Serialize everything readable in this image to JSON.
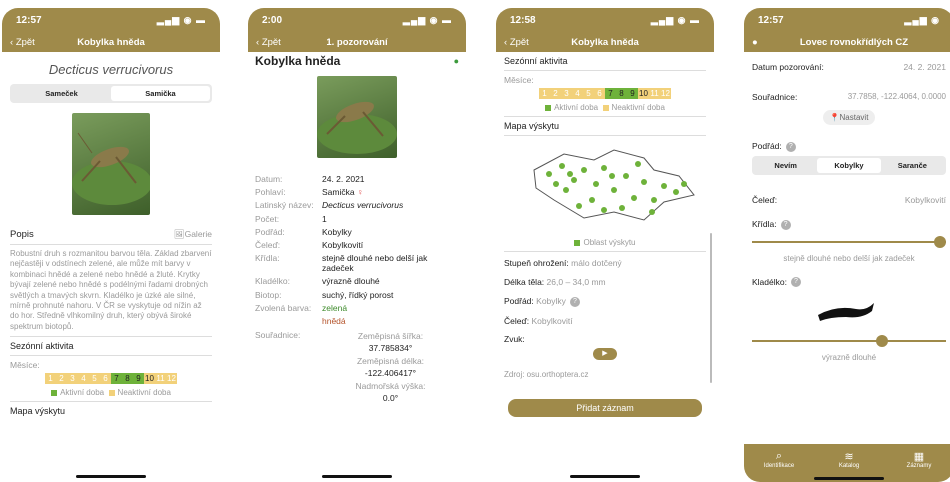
{
  "colors": {
    "brand": "#9f8a4a",
    "active": "#6eb23a",
    "inactive": "#f2d17a",
    "female": "#e04b4b",
    "green_text": "#3c8a2a",
    "brown_text": "#b4532a"
  },
  "s1": {
    "time": "12:57",
    "back": "Zpět",
    "title": "Kobylka hněda",
    "latin": "Decticus verrucivorus",
    "seg": [
      "Sameček",
      "Samička"
    ],
    "popis_label": "Popis",
    "galerie": "Galerie",
    "popis_text": "Robustní druh s rozmanitou barvou těla. Základ zbarvení nejčastěji v odstínech zelené, ale může mít barvy v kombinaci hnědé a zelené nebo hnědé a žluté. Krytky bývají zelené nebo hnědé s podélnými řadami drobných světlých a tmavých skvrn. Kladélko je úzké ale silné, mírně prohnuté nahoru. V ČR se vyskytuje od nížin až do hor. Středně vlhkomilný druh, který obývá široké spektrum biotopů.",
    "sezonni": "Sezónní aktivita",
    "mesice": "Měsíce:",
    "months": [
      "1",
      "2",
      "3",
      "4",
      "5",
      "6",
      "7",
      "8",
      "9",
      "10",
      "11",
      "12"
    ],
    "aktivni": "Aktivní doba",
    "neaktivni": "Neaktivní doba",
    "mapa": "Mapa výskytu"
  },
  "s2": {
    "time": "2:00",
    "back": "Zpět",
    "title": "1. pozorování",
    "name": "Kobylka hněda",
    "rows": [
      {
        "k": "Datum:",
        "v": "24. 2. 2021"
      },
      {
        "k": "Pohlaví:",
        "v": "Samička"
      },
      {
        "k": "Latinský název:",
        "v": "Decticus verrucivorus"
      },
      {
        "k": "Počet:",
        "v": "1"
      },
      {
        "k": "Podřád:",
        "v": "Kobylky"
      },
      {
        "k": "Čeleď:",
        "v": "Kobylkovití"
      },
      {
        "k": "Křídla:",
        "v": "stejně dlouhé nebo delší jak zadeček"
      },
      {
        "k": "Kladélko:",
        "v": "výrazně dlouhé"
      },
      {
        "k": "Biotop:",
        "v": "suchý, řídký porost"
      }
    ],
    "barva_k": "Zvolená barva:",
    "barva1": "zelená",
    "barva2": "hnědá",
    "souradnice_k": "Souřadnice:",
    "sirka_label": "Zeměpisná šířka:",
    "sirka": "37.785834°",
    "delka_label": "Zeměpisná délka:",
    "delka": "-122.406417°",
    "vyska_label": "Nadmořská výška:",
    "vyska": "0.0°"
  },
  "s3": {
    "time": "12:58",
    "back": "Zpět",
    "title": "Kobylka hněda",
    "sezonni": "Sezónní aktivita",
    "mesice": "Měsíce:",
    "aktivni": "Aktivní doba",
    "neaktivni": "Neaktivní doba",
    "mapa": "Mapa výskytu",
    "oblast": "Oblast výskytu",
    "stupen_k": "Stupeň ohrožení:",
    "stupen_v": "málo dotčený",
    "delka_k": "Délka těla:",
    "delka_v": "26,0 – 34,0 mm",
    "podrad_k": "Podřád:",
    "podrad_v": "Kobylky",
    "celed_k": "Čeleď:",
    "celed_v": "Kobylkovití",
    "zvuk_k": "Zvuk:",
    "zdroj": "Zdroj:  osu.orthoptera.cz",
    "pridat": "Přidat záznam"
  },
  "s4": {
    "time": "12:57",
    "title": "Lovec rovnokřídlých CZ",
    "datum_k": "Datum pozorování:",
    "datum_v": "24. 2. 2021",
    "souradnice_k": "Souřadnice:",
    "souradnice_v": "37.7858, -122.4064, 0.0000",
    "nastavit": "Nastavit",
    "podrad_k": "Podřád:",
    "seg": [
      "Nevím",
      "Kobylky",
      "Saranče"
    ],
    "celed_k": "Čeleď:",
    "celed_v": "Kobylkovití",
    "kridla_k": "Křídla:",
    "kridla_v": "stejně dlouhé nebo delší jak zadeček",
    "kridla_level": 1.0,
    "kladelko_k": "Kladélko:",
    "kladelko_v": "výrazně dlouhé",
    "kladelko_level": 0.68,
    "tabs": [
      "Identifikace",
      "Katalog",
      "Záznamy"
    ]
  }
}
